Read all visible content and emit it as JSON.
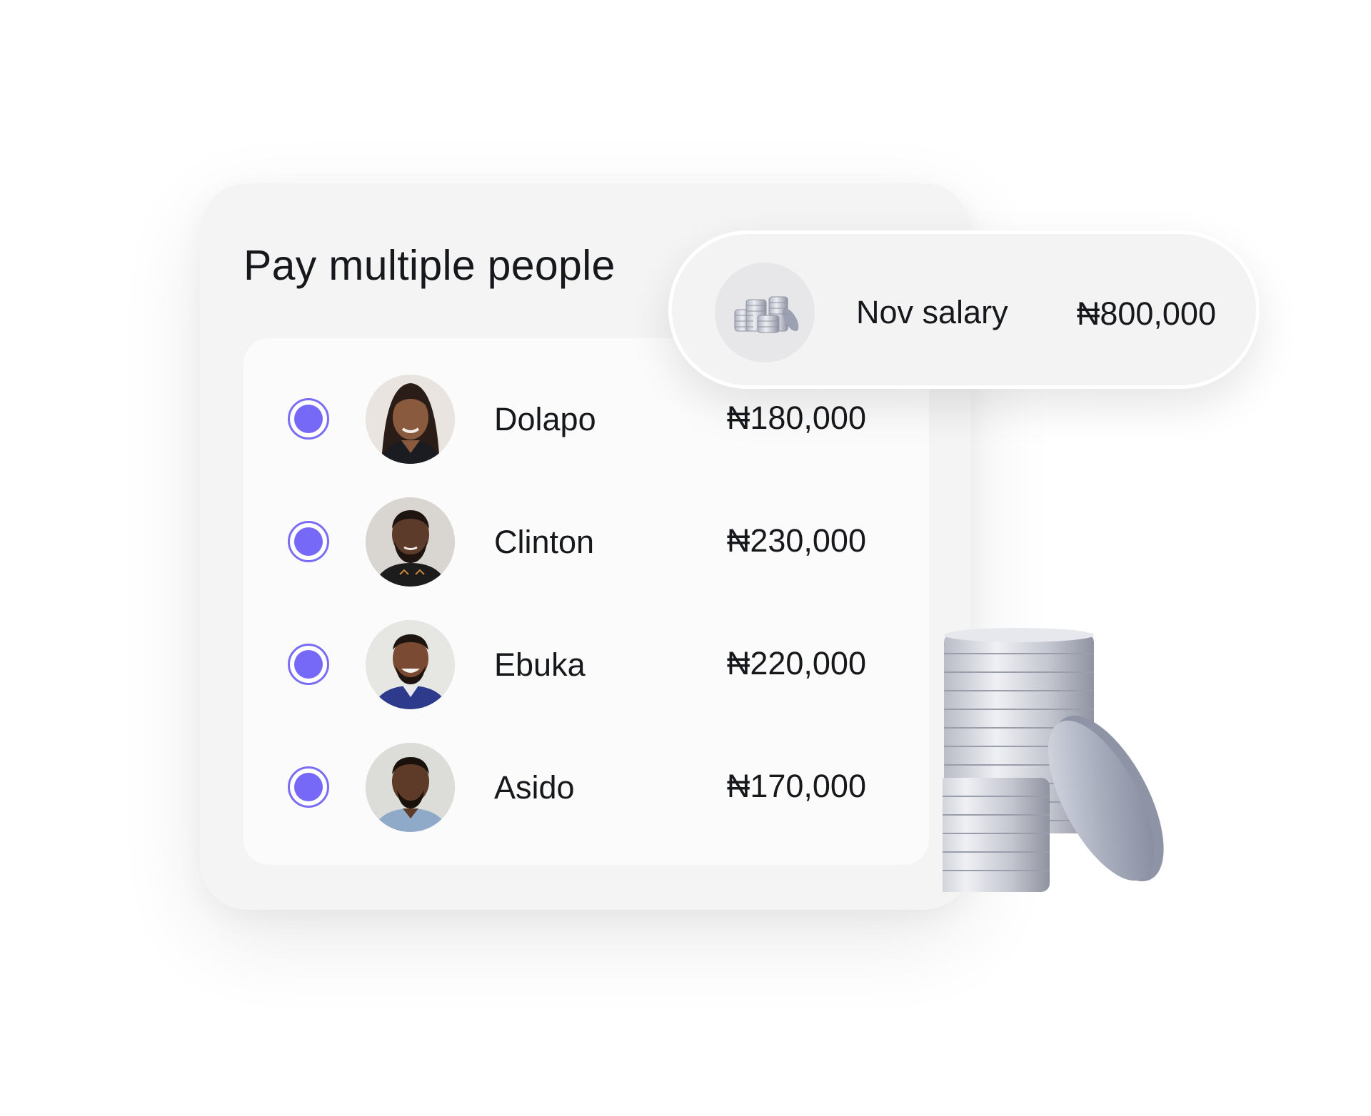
{
  "card": {
    "title": "Pay multiple people"
  },
  "people": [
    {
      "name": "Dolapo",
      "amount": "₦180,000",
      "selected": true,
      "avatar": "person-photo"
    },
    {
      "name": "Clinton",
      "amount": "₦230,000",
      "selected": true,
      "avatar": "person-photo"
    },
    {
      "name": "Ebuka",
      "amount": "₦220,000",
      "selected": true,
      "avatar": "person-photo"
    },
    {
      "name": "Asido",
      "amount": "₦170,000",
      "selected": true,
      "avatar": "person-photo"
    }
  ],
  "salary": {
    "label": "Nov salary",
    "amount": "₦800,000",
    "icon": "coins-icon"
  },
  "colors": {
    "accent": "#7669f8",
    "card_background": "#f4f4f5",
    "panel_background": "#fbfbfb",
    "text": "#17181c"
  }
}
